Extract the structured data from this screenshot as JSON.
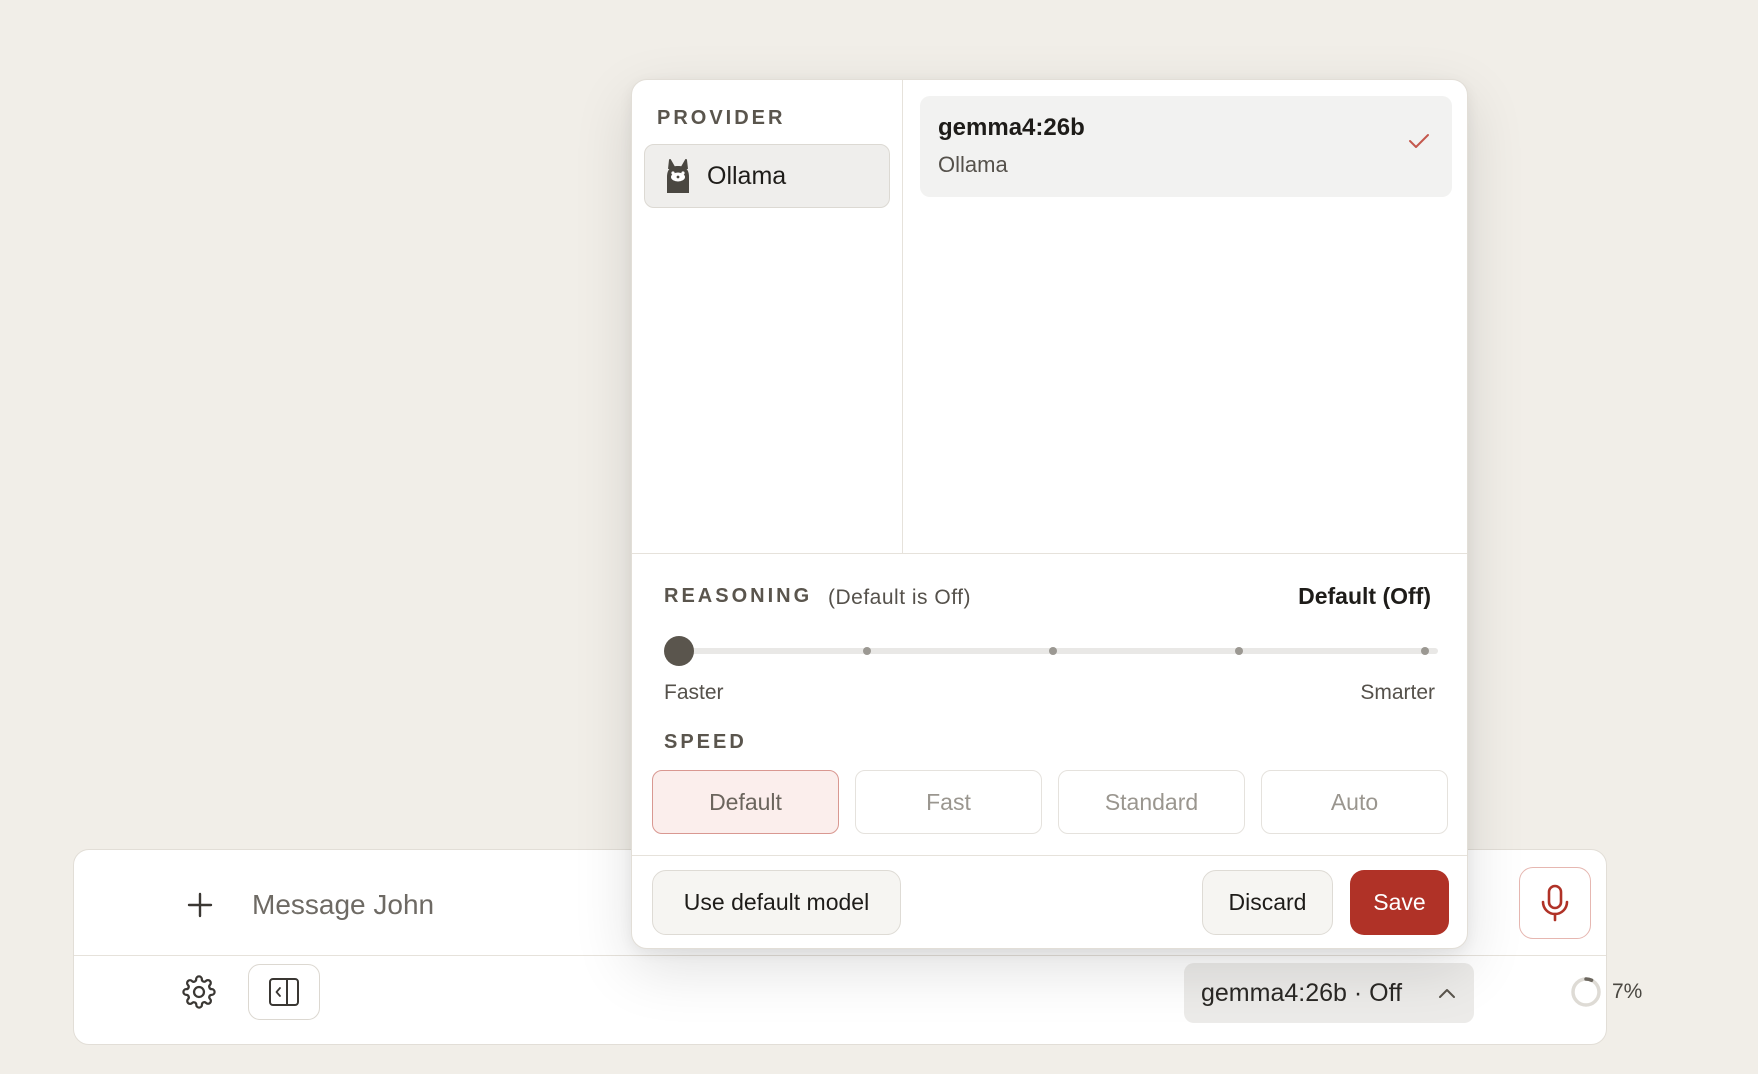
{
  "composer": {
    "placeholder": "Message John",
    "model_chip_label": "gemma4:26b · Off",
    "usage_percent": "7%",
    "usage_fraction": 0.07
  },
  "popover": {
    "provider_heading": "PROVIDER",
    "providers": [
      {
        "name": "Ollama",
        "icon": "llama-icon",
        "selected": true
      }
    ],
    "models": [
      {
        "name": "gemma4:26b",
        "provider": "Ollama",
        "selected": true
      }
    ],
    "reasoning": {
      "heading": "REASONING",
      "hint": "(Default is Off)",
      "value": "Default (Off)",
      "min_label": "Faster",
      "max_label": "Smarter",
      "steps": 5,
      "selected_step": 0
    },
    "speed": {
      "heading": "SPEED",
      "options": [
        "Default",
        "Fast",
        "Standard",
        "Auto"
      ],
      "selected": "Default"
    },
    "buttons": {
      "use_default": "Use default model",
      "discard": "Discard",
      "save": "Save"
    }
  },
  "colors": {
    "accent": "#b03227",
    "background": "#f1eee8"
  }
}
